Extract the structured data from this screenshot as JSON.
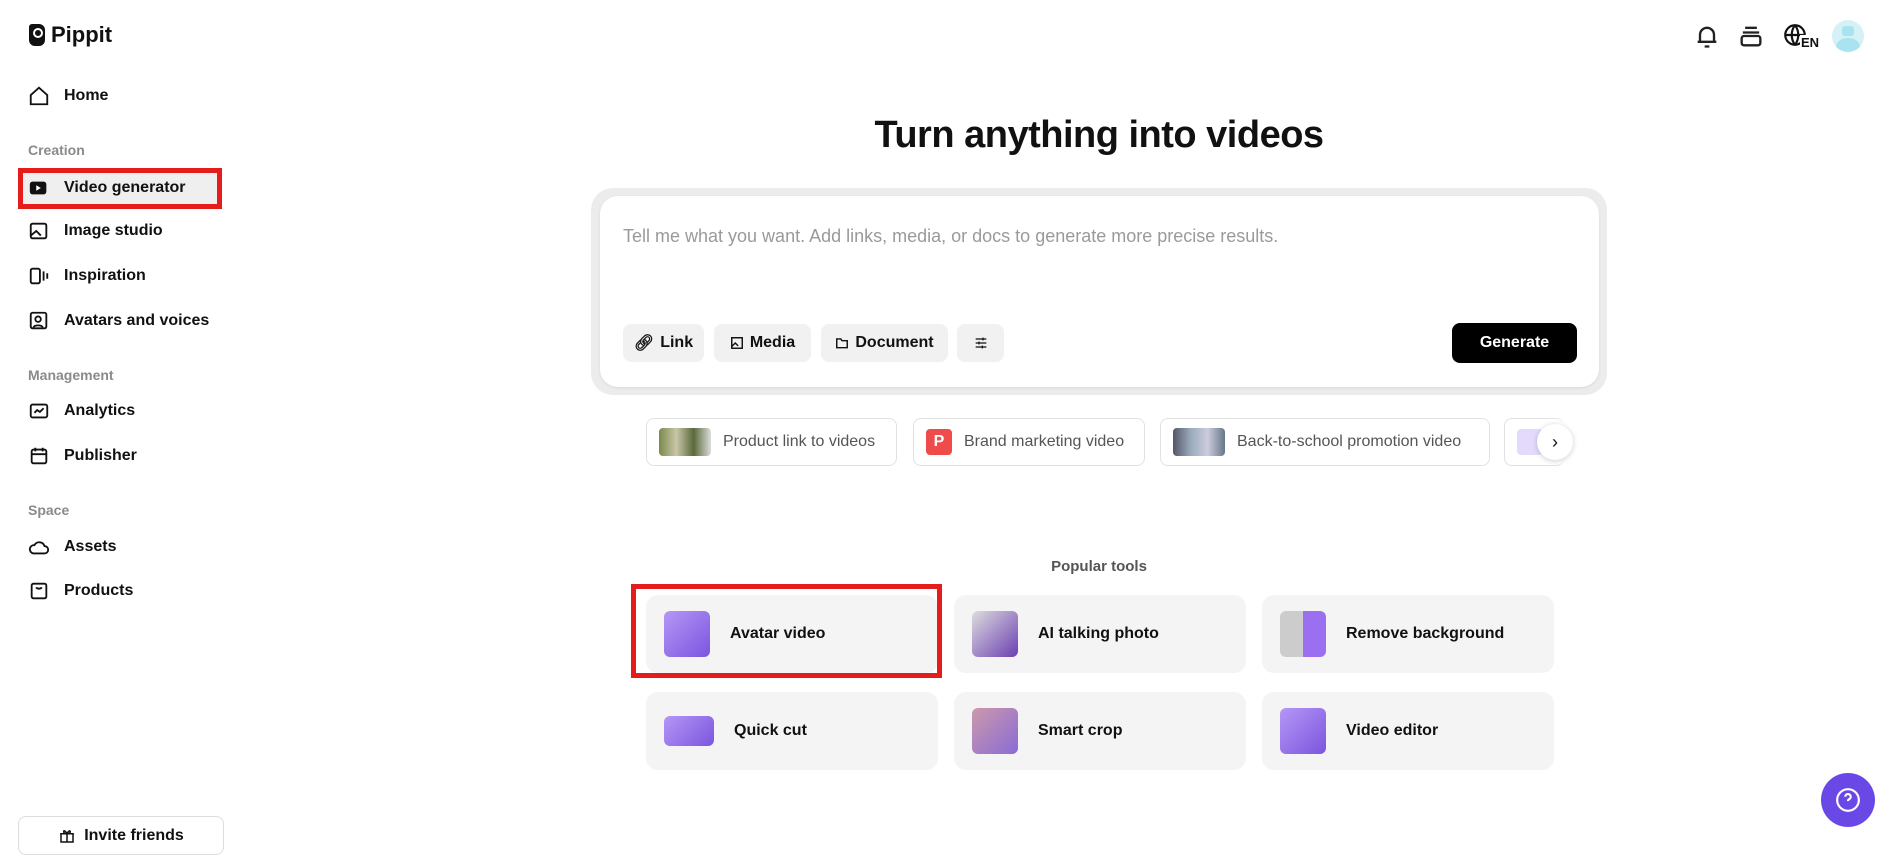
{
  "brand": "Pippit",
  "sidebar": {
    "home": "Home",
    "sections": {
      "creation": "Creation",
      "management": "Management",
      "space": "Space"
    },
    "items": {
      "video_generator": "Video generator",
      "image_studio": "Image studio",
      "inspiration": "Inspiration",
      "avatars": "Avatars and voices",
      "analytics": "Analytics",
      "publisher": "Publisher",
      "assets": "Assets",
      "products": "Products"
    },
    "invite": "Invite friends"
  },
  "header": {
    "language": "EN"
  },
  "main": {
    "title": "Turn anything into videos",
    "prompt_placeholder": "Tell me what you want. Add links, media, or docs to generate more precise results.",
    "buttons": {
      "link": "Link",
      "media": "Media",
      "document": "Document",
      "generate": "Generate"
    },
    "suggestions": [
      "Product link to videos",
      "Brand marketing video",
      "Back-to-school promotion video"
    ],
    "brand_badge": "P",
    "popular_label": "Popular tools",
    "tools": [
      "Avatar video",
      "AI talking photo",
      "Remove background",
      "Quick cut",
      "Smart crop",
      "Video editor"
    ]
  },
  "colors": {
    "highlight": "#e51c1c",
    "help": "#6a48e6",
    "brand_badge": "#f04b4b"
  }
}
